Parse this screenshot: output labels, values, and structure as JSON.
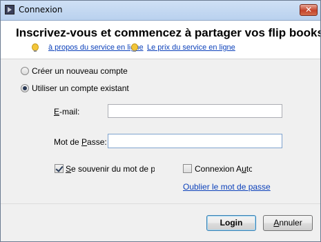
{
  "window": {
    "title": "Connexion",
    "close_symbol": "✕"
  },
  "header": {
    "headline": "Inscrivez-vous et commencez à partager vos flip books en ligne",
    "link_about": "à propos du service en ligne",
    "link_price": "Le prix du service en ligne"
  },
  "account": {
    "option_new": "Créer un nouveau compte",
    "option_existing": "Utiliser un compte existant"
  },
  "form": {
    "email_label_hotkey": "E",
    "email_label_rest": "-mail:",
    "email_value": "",
    "password_label_prefix": "Mot de ",
    "password_label_hotkey": "P",
    "password_label_rest": "asse:",
    "password_value": "",
    "remember_hotkey": "S",
    "remember_rest": "e souvenir du mot de passe",
    "autologin_prefix": "Connexion A",
    "autologin_hotkey": "u",
    "autologin_rest": "tomatique",
    "forgot_link": "Oublier le mot de passe"
  },
  "buttons": {
    "login_label": "Login",
    "cancel_hotkey": "A",
    "cancel_rest": "nnuler"
  },
  "icons": {
    "app": "flipbook-app-icon",
    "tip": "lightbulb-icon",
    "close": "close-icon"
  }
}
